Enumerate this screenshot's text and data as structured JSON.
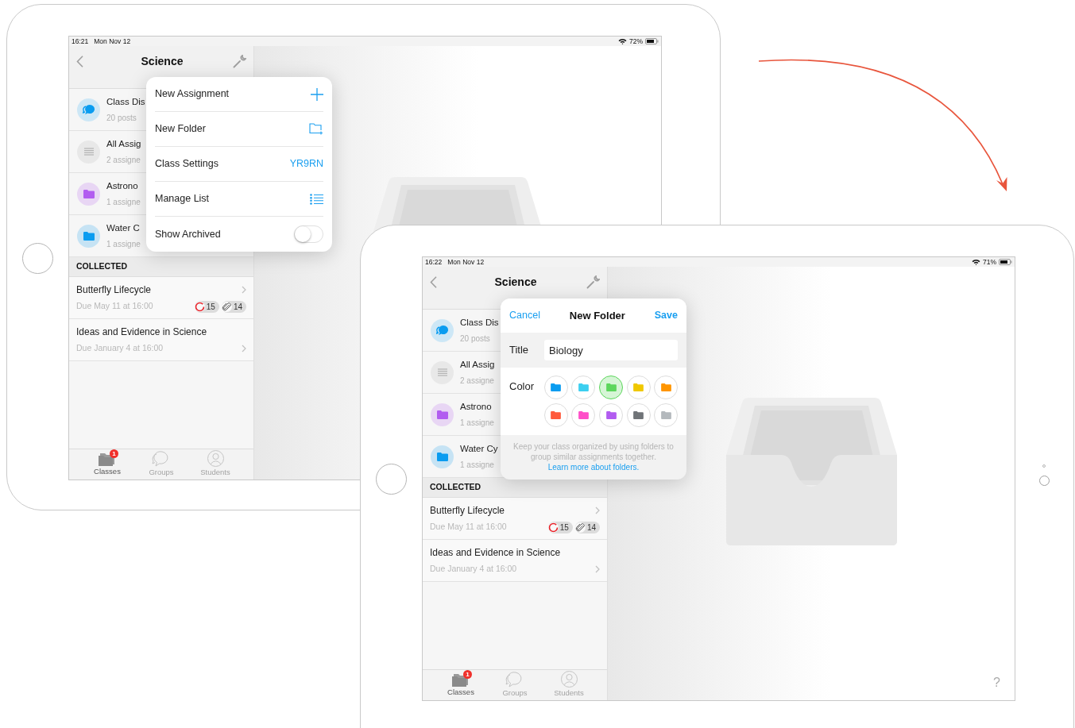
{
  "devices": [
    {
      "status_bar": {
        "time": "16:21",
        "date": "Mon Nov 12",
        "battery": "72%"
      },
      "sidebar": {
        "title": "Science",
        "items": [
          {
            "kind": "discussion",
            "title": "Class Dis",
            "subtitle": "20 posts"
          },
          {
            "kind": "list",
            "title": "All Assig",
            "subtitle": "2 assigne"
          },
          {
            "kind": "folder",
            "color": "#b25cf0",
            "title": "Astrono",
            "subtitle": "1 assigne"
          },
          {
            "kind": "folder",
            "color": "#0a9cf0",
            "title": "Water C",
            "subtitle": "1 assigne"
          }
        ],
        "section_header": "COLLECTED",
        "assignments": [
          {
            "title": "Butterfly Lifecycle",
            "due": "Due May 11 at 16:00",
            "pending": "15",
            "attachments": "14"
          },
          {
            "title": "Ideas and Evidence in Science",
            "due": "Due January 4 at 16:00"
          }
        ],
        "tab_bar": [
          {
            "kind": "classes",
            "label": "Classes",
            "selected": true,
            "badge": "1"
          },
          {
            "kind": "groups",
            "label": "Groups",
            "selected": false
          },
          {
            "kind": "students",
            "label": "Students",
            "selected": false
          }
        ]
      },
      "popover": {
        "kind": "menu",
        "items": [
          {
            "kind": "add",
            "label": "New Assignment"
          },
          {
            "kind": "folder",
            "label": "New Folder"
          },
          {
            "kind": "code",
            "label": "Class Settings",
            "value": "YR9RN"
          },
          {
            "kind": "list",
            "label": "Manage List"
          },
          {
            "kind": "toggle",
            "label": "Show Archived",
            "on": false
          }
        ]
      }
    },
    {
      "status_bar": {
        "time": "16:22",
        "date": "Mon Nov 12",
        "battery": "71%"
      },
      "sidebar": {
        "title": "Science",
        "items": [
          {
            "kind": "discussion",
            "title": "Class Dis",
            "subtitle": "20 posts"
          },
          {
            "kind": "list",
            "title": "All Assig",
            "subtitle": "2 assigne"
          },
          {
            "kind": "folder",
            "color": "#b25cf0",
            "title": "Astrono",
            "subtitle": "1 assigne"
          },
          {
            "kind": "folder",
            "color": "#0a9cf0",
            "title": "Water Cy",
            "subtitle": "1 assigne"
          }
        ],
        "section_header": "COLLECTED",
        "assignments": [
          {
            "title": "Butterfly Lifecycle",
            "due": "Due May 11 at 16:00",
            "pending": "15",
            "attachments": "14"
          },
          {
            "title": "Ideas and Evidence in Science",
            "due": "Due January 4 at 16:00"
          }
        ],
        "tab_bar": [
          {
            "kind": "classes",
            "label": "Classes",
            "selected": true,
            "badge": "1"
          },
          {
            "kind": "groups",
            "label": "Groups",
            "selected": false
          },
          {
            "kind": "students",
            "label": "Students",
            "selected": false
          }
        ]
      },
      "popover": {
        "kind": "new_folder",
        "cancel": "Cancel",
        "title": "New Folder",
        "save": "Save",
        "title_label": "Title",
        "title_value": "Biology",
        "color_label": "Color",
        "colors": [
          {
            "color": "#0a9cf0",
            "selected": false
          },
          {
            "color": "#3ccff0",
            "selected": false
          },
          {
            "color": "#5cd65c",
            "selected": true
          },
          {
            "color": "#f0c800",
            "selected": false
          },
          {
            "color": "#ff9500",
            "selected": false
          },
          {
            "color": "#ff5a3c",
            "selected": false
          },
          {
            "color": "#ff4fc8",
            "selected": false
          },
          {
            "color": "#b25cf0",
            "selected": false
          },
          {
            "color": "#707478",
            "selected": false
          },
          {
            "color": "#b4b9bd",
            "selected": false
          }
        ],
        "hint": "Keep your class organized by using folders to group similar assignments together.",
        "link": "Learn more about folders."
      },
      "help": "?"
    }
  ]
}
